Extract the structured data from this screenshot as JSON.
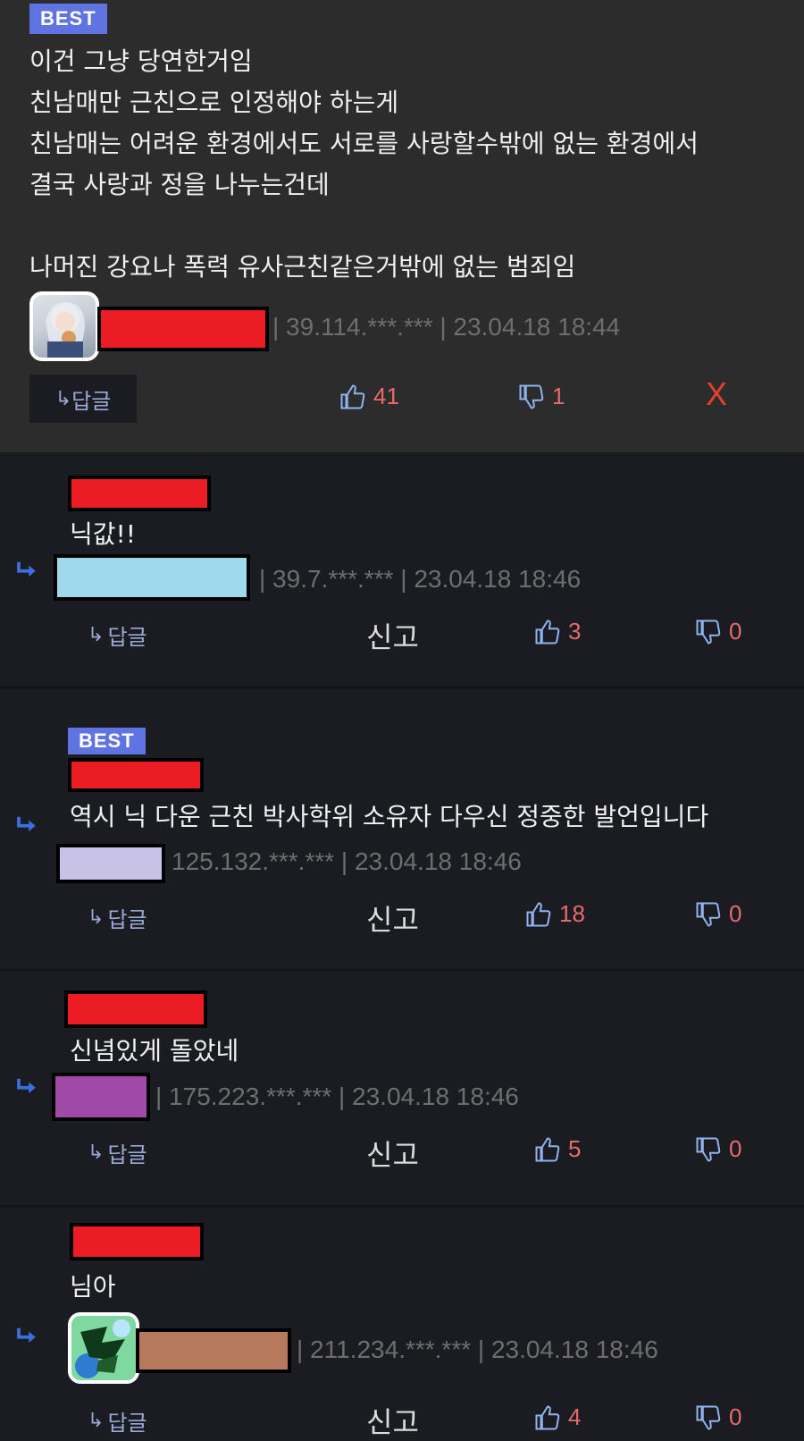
{
  "best_comment": {
    "badge": "BEST",
    "text": "이건 그냥 당연한거임\n친남매만 근친으로 인정해야 하는게\n친남매는 어려운 환경에서도 서로를 사랑할수밖에 없는 환경에서\n결국 사랑과 정을 나누는건데\n\n나머진 강요나 폭력 유사근친같은거밖에 없는 범죄임",
    "meta": "| 39.114.***.*** | 23.04.18 18:44",
    "reply_label": "답글",
    "likes": "41",
    "dislikes": "1",
    "close_label": "X"
  },
  "replies": [
    {
      "text": "닉값!!",
      "meta": "| 39.7.***.*** | 23.04.18 18:46",
      "reply_label": "답글",
      "report_label": "신고",
      "likes": "3",
      "dislikes": "0"
    },
    {
      "badge": "BEST",
      "text": "역시 닉 다운 근친 박사학위 소유자 다우신 정중한 발언입니다",
      "meta": "125.132.***.*** | 23.04.18 18:46",
      "reply_label": "답글",
      "report_label": "신고",
      "likes": "18",
      "dislikes": "0"
    },
    {
      "text": "신념있게 돌았네",
      "meta": "| 175.223.***.*** | 23.04.18 18:46",
      "reply_label": "답글",
      "report_label": "신고",
      "likes": "5",
      "dislikes": "0"
    },
    {
      "text": "님아",
      "meta": "| 211.234.***.*** | 23.04.18 18:46",
      "reply_label": "답글",
      "report_label": "신고",
      "likes": "4",
      "dislikes": "0"
    }
  ],
  "colors": {
    "redaction_red": "#ec1c24",
    "swatch_blue": "#9dd9ea",
    "swatch_lavender": "#c8c2e6",
    "swatch_purple": "#a04aa8",
    "swatch_brown": "#b87a5c",
    "badge": "#5f74e0",
    "accent_red": "#e76a6a",
    "reply_arrow": "#3b6fe0"
  },
  "icons": [
    "thumbs-up-icon",
    "thumbs-down-icon",
    "reply-arrow-icon"
  ]
}
